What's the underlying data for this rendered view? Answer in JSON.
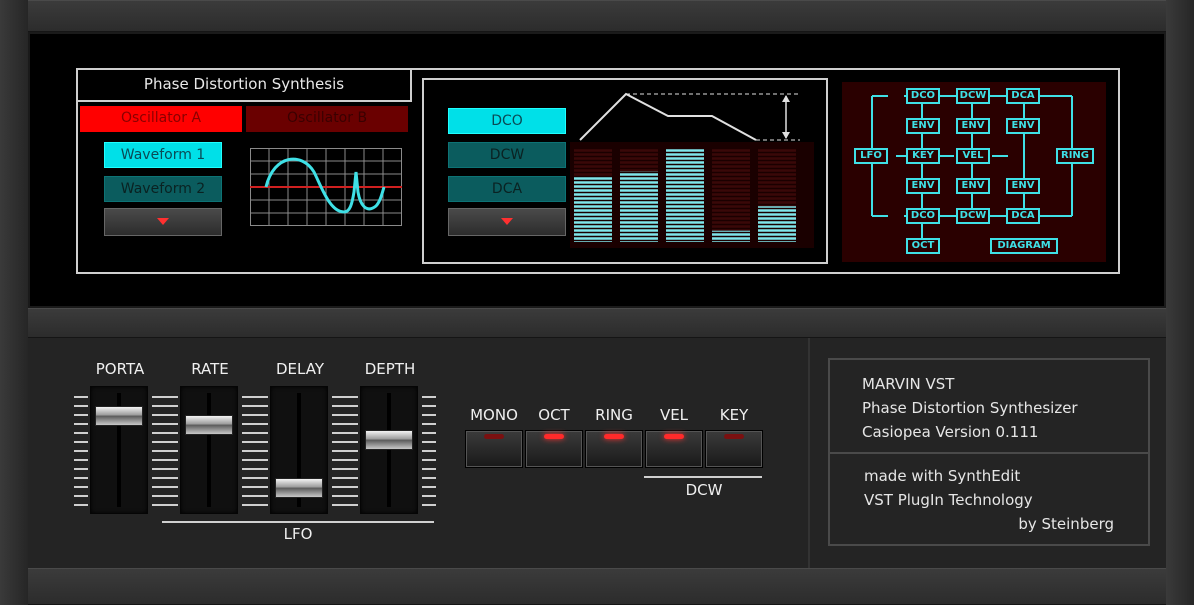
{
  "header": {
    "title": "Phase Distortion Synthesis"
  },
  "oscillator_tabs": [
    {
      "label": "Oscillator A",
      "active": true
    },
    {
      "label": "Oscillator B",
      "active": false
    }
  ],
  "waveform_buttons": [
    {
      "label": "Waveform 1",
      "active": true
    },
    {
      "label": "Waveform 2",
      "active": false
    }
  ],
  "section_buttons": [
    {
      "label": "DCO",
      "active": true
    },
    {
      "label": "DCW",
      "active": false
    },
    {
      "label": "DCA",
      "active": false
    }
  ],
  "envelope_bars": [
    0.7,
    0.75,
    1.0,
    0.12,
    0.38
  ],
  "diagram_nodes": {
    "top_dco": "DCO",
    "top_dcw": "DCW",
    "top_dca": "DCA",
    "env1": "ENV",
    "env2": "ENV",
    "env3": "ENV",
    "lfo": "LFO",
    "key": "KEY",
    "vel": "VEL",
    "ring": "RING",
    "env4": "ENV",
    "env5": "ENV",
    "env6": "ENV",
    "bot_dco": "DCO",
    "bot_dcw": "DCW",
    "bot_dca": "DCA",
    "oct": "OCT",
    "diagram": "DIAGRAM"
  },
  "sliders": [
    {
      "label": "PORTA",
      "level": 0.88
    },
    {
      "label": "RATE",
      "level": 0.78
    },
    {
      "label": "DELAY",
      "level": 0.1
    },
    {
      "label": "DEPTH",
      "level": 0.62
    }
  ],
  "lfo_label": "LFO",
  "switches": [
    {
      "label": "MONO",
      "on": false
    },
    {
      "label": "OCT",
      "on": true
    },
    {
      "label": "RING",
      "on": true
    },
    {
      "label": "VEL",
      "on": true
    },
    {
      "label": "KEY",
      "on": false
    }
  ],
  "dcw_label": "DCW",
  "info": {
    "line1": "MARVIN VST",
    "line2": "Phase Distortion Synthesizer",
    "line3": "Casiopea Version 0.111",
    "line4": "made with SynthEdit",
    "line5": "VST PlugIn Technology",
    "line6": "by Steinberg"
  },
  "colors": {
    "cyan": "#00e0e8",
    "teal": "#0b5c5e",
    "red": "#ff0000",
    "dark_red": "#7a0000",
    "diagram_bg": "#2a0000"
  }
}
